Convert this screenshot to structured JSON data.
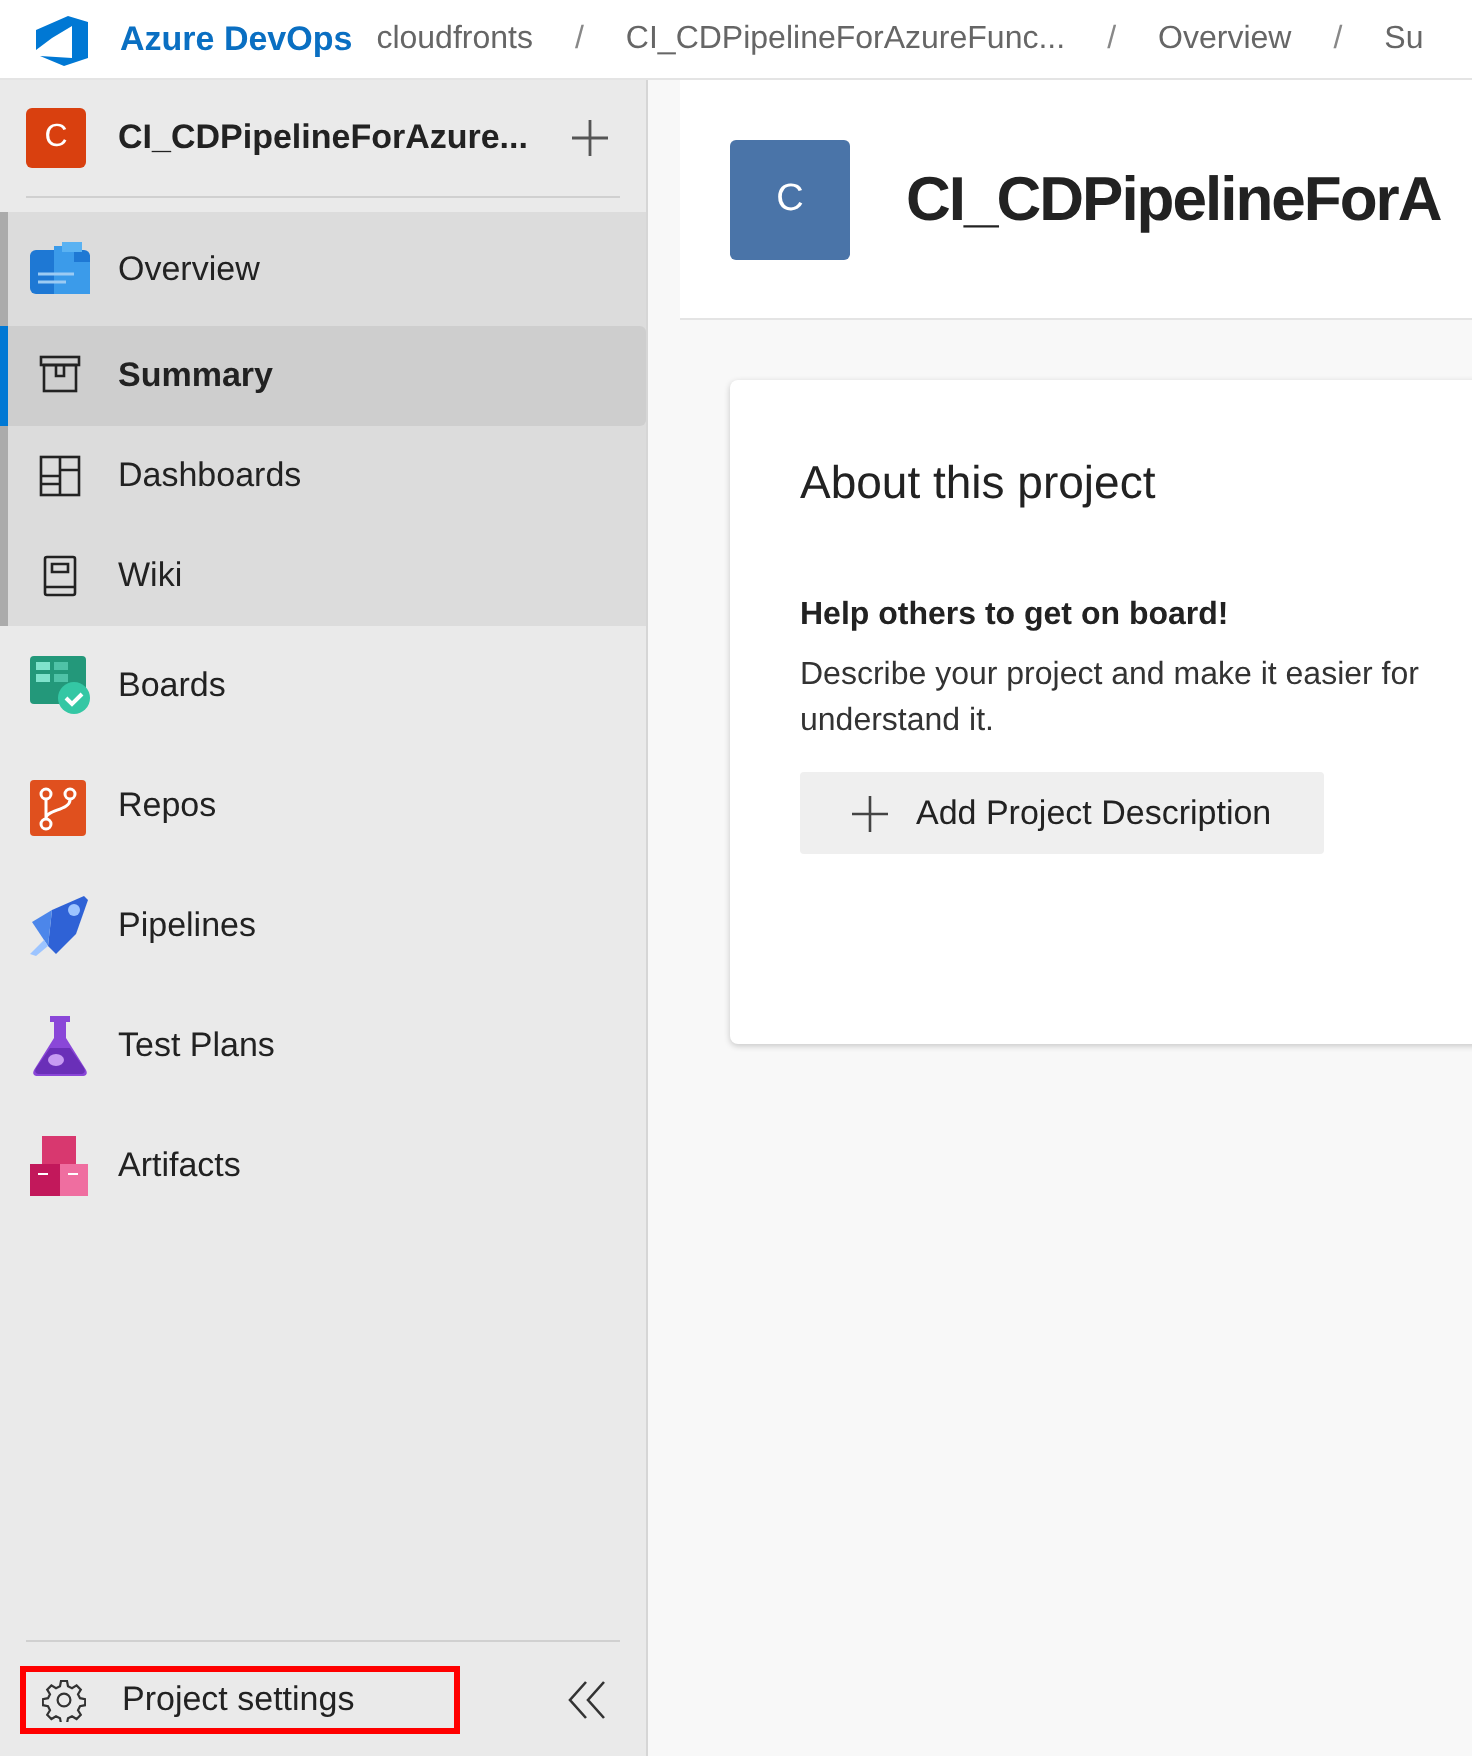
{
  "topbar": {
    "brand": "Azure DevOps",
    "breadcrumbs": [
      {
        "kind": "link",
        "text": "cloudfronts"
      },
      {
        "kind": "separator",
        "text": "/"
      },
      {
        "kind": "link",
        "text": "CI_CDPipelineForAzureFunc..."
      },
      {
        "kind": "separator",
        "text": "/"
      },
      {
        "kind": "link",
        "text": "Overview"
      },
      {
        "kind": "separator",
        "text": "/"
      },
      {
        "kind": "link",
        "text": "Su"
      }
    ]
  },
  "sidebar": {
    "project": {
      "initial": "C",
      "name": "CI_CDPipelineForAzure..."
    },
    "nav": [
      {
        "label": "Overview",
        "selected": false,
        "expanded": true,
        "children": [
          {
            "label": "Summary",
            "selected": true
          },
          {
            "label": "Dashboards",
            "selected": false
          },
          {
            "label": "Wiki",
            "selected": false
          }
        ]
      },
      {
        "label": "Boards",
        "selected": false,
        "expanded": false
      },
      {
        "label": "Repos",
        "selected": false,
        "expanded": false
      },
      {
        "label": "Pipelines",
        "selected": false,
        "expanded": false
      },
      {
        "label": "Test Plans",
        "selected": false,
        "expanded": false
      },
      {
        "label": "Artifacts",
        "selected": false,
        "expanded": false
      }
    ],
    "settings": {
      "label": "Project settings",
      "highlighted": true
    }
  },
  "main": {
    "initial": "C",
    "title": "CI_CDPipelineForA",
    "card": {
      "title": "About this project",
      "subtitle": "Help others to get on board!",
      "text": "Describe your project and make it easier for understand it.",
      "button": "Add Project Description"
    }
  }
}
